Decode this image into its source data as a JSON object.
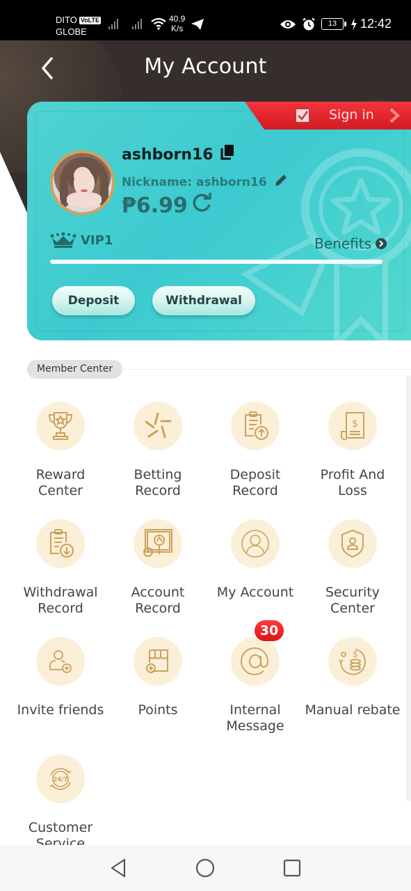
{
  "status_bar": {
    "carrier_1": "DITO",
    "volte": "VoLTE",
    "carrier_2": "GLOBE",
    "net_speed_value": "40.9",
    "net_speed_unit": "K/s",
    "battery": "13",
    "time": "12:42",
    "icons": [
      "signal-icon",
      "signal-icon",
      "wifi-icon",
      "telegram-icon",
      "eye-icon",
      "alarm-icon",
      "battery-icon",
      "charging-icon"
    ]
  },
  "header": {
    "title": "My Account",
    "back_icon": "chevron-left-icon"
  },
  "account_card": {
    "sign_in_label": "Sign in",
    "username": "ashborn16",
    "nickname_label": "Nickname: ashborn16",
    "balance": "₱6.99",
    "vip_level": "VIP1",
    "benefits_label": "Benefits",
    "vip_progress_percent": 100,
    "deposit_label": "Deposit",
    "withdrawal_label": "Withdrawal"
  },
  "member_center": {
    "section_title": "Member Center",
    "items": [
      {
        "label": "Reward Center",
        "icon": "trophy-icon"
      },
      {
        "label": "Betting Record",
        "icon": "betting-icon"
      },
      {
        "label": "Deposit Record",
        "icon": "clipboard-upload-icon"
      },
      {
        "label": "Profit And Loss",
        "icon": "receipt-icon"
      },
      {
        "label": "Withdrawal Record",
        "icon": "clipboard-download-icon"
      },
      {
        "label": "Account Record",
        "icon": "account-record-icon"
      },
      {
        "label": "My Account",
        "icon": "user-icon"
      },
      {
        "label": "Security Center",
        "icon": "shield-user-icon"
      },
      {
        "label": "Invite friends",
        "icon": "invite-user-icon"
      },
      {
        "label": "Points",
        "icon": "shop-icon"
      },
      {
        "label": "Internal Message",
        "icon": "at-icon",
        "badge": "30"
      },
      {
        "label": "Manual rebate",
        "icon": "coins-rebate-icon"
      },
      {
        "label": "Customer Service",
        "icon": "support-24-7-icon"
      }
    ]
  },
  "nav_bar": {
    "back": "nav-back-icon",
    "home": "nav-home-icon",
    "recents": "nav-recents-icon"
  },
  "colors": {
    "header_bg": "#352e2c",
    "card_teal": "#3ccad0",
    "sign_in_red": "#e0232a",
    "icon_gold": "#c9a25c",
    "icon_circle": "#fcefd8",
    "badge_red": "#e81c1c"
  }
}
